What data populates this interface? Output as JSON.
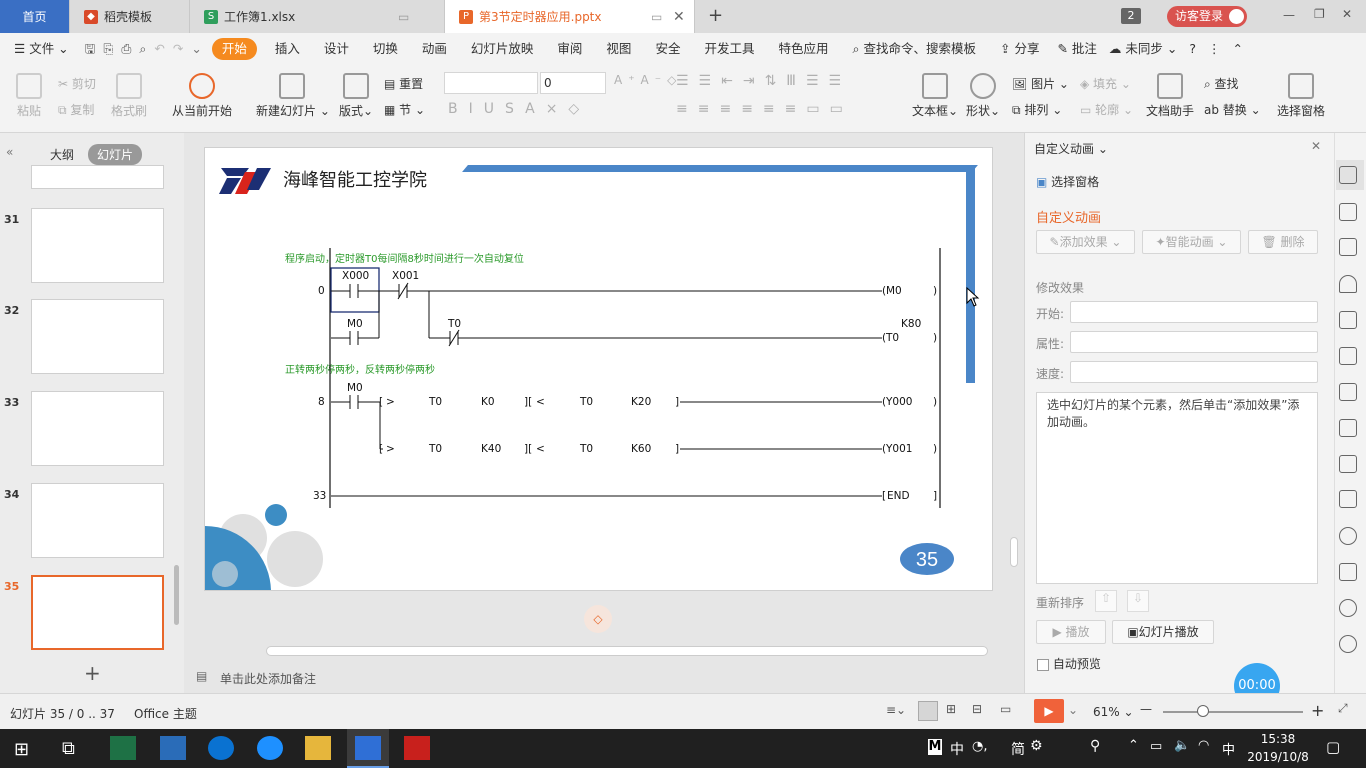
{
  "tabs": {
    "home": "首页",
    "t1": "稻壳模板",
    "t2": "工作簿1.xlsx",
    "t3": "第3节定时器应用.pptx",
    "badge": "2",
    "login": "访客登录"
  },
  "menu": {
    "file": "文件",
    "items": [
      "开始",
      "插入",
      "设计",
      "切换",
      "动画",
      "幻灯片放映",
      "审阅",
      "视图",
      "安全",
      "开发工具",
      "特色应用"
    ],
    "search": "查找命令、搜索模板",
    "share": "分享",
    "comment": "批注",
    "sync": "未同步"
  },
  "ribbon": {
    "paste": "粘贴",
    "cut": "剪切",
    "copy": "复制",
    "format": "格式刷",
    "fromstart": "从当前开始",
    "newslide": "新建幻灯片",
    "layout": "版式",
    "reset": "重置",
    "section": "节",
    "fontsize": "0",
    "textbox": "文本框",
    "shape": "形状",
    "picture": "图片",
    "fill": "填充",
    "arrange": "排列",
    "outline": "轮廓",
    "dochelper": "文档助手",
    "find": "查找",
    "replace": "替换",
    "selpane": "选择窗格"
  },
  "left": {
    "outline": "大纲",
    "slides": "幻灯片",
    "nums": [
      "31",
      "32",
      "33",
      "34",
      "35"
    ],
    "add": "+"
  },
  "slide": {
    "school": "海峰智能工控学院",
    "comment1": "程序启动，定时器T0每间隔8秒时间进行一次自动复位",
    "comment2": "正转两秒停两秒，反转两秒停两秒",
    "rung0": "0",
    "rung8": "8",
    "rung33": "33",
    "x000": "X000",
    "x001": "X001",
    "m0": "M0",
    "m0b": "M0",
    "m0c": "M0",
    "t0": "T0",
    "k80": "K80",
    "t0coil": "T0",
    "y000": "Y000",
    "y001": "Y001",
    "end": "END",
    "c1": [
      ">",
      "T0",
      "K0",
      "<",
      "T0",
      "K20"
    ],
    "c2": [
      ">",
      "T0",
      "K40",
      "<",
      "T0",
      "K60"
    ],
    "page": "35"
  },
  "notes": "单击此处添加备注",
  "right": {
    "title": "自定义动画",
    "selpane": "选择窗格",
    "heading": "自定义动画",
    "add": "添加效果",
    "smart": "智能动画",
    "del": "删除",
    "modify": "修改效果",
    "start": "开始:",
    "prop": "属性:",
    "speed": "速度:",
    "hint": "选中幻灯片的某个元素，然后单击“添加效果”添加动画。",
    "reorder": "重新排序",
    "play": "播放",
    "slideplay": "幻灯片播放",
    "autopreview": "自动预览",
    "timer": "00:00"
  },
  "status": {
    "slideinfo": "幻灯片 35 / 0 .. 37",
    "theme": "Office 主题",
    "zoom": "61%"
  },
  "taskbar": {
    "ime": "中",
    "ime2": "简",
    "time": "15:38",
    "date": "2019/10/8",
    "lang": "中"
  }
}
